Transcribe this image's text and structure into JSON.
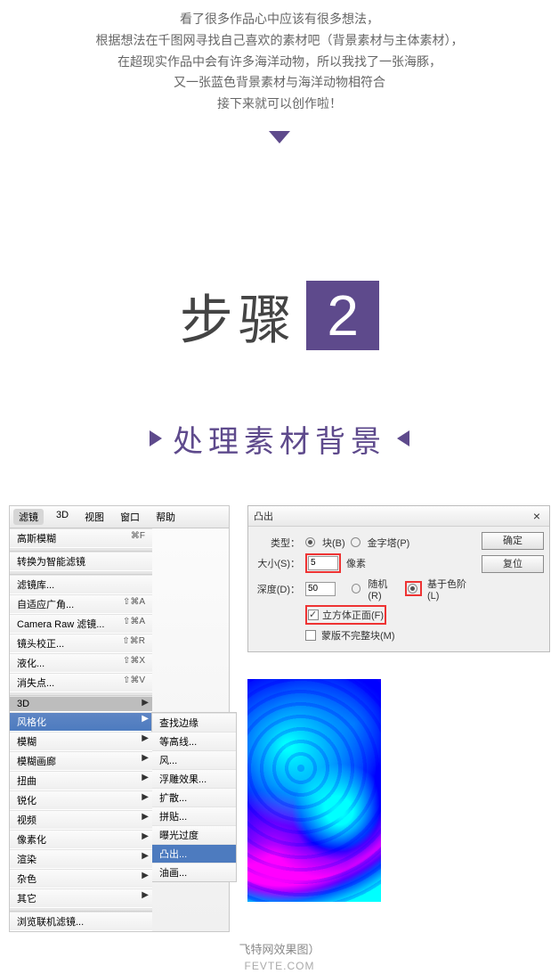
{
  "intro": {
    "line1": "看了很多作品心中应该有很多想法，",
    "line2": "根据想法在千图网寻找自己喜欢的素材吧（背景素材与主体素材），",
    "line3": "在超现实作品中会有许多海洋动物，所以我找了一张海豚，",
    "line4": "又一张蓝色背景素材与海洋动物相符合",
    "line5": "接下来就可以创作啦！"
  },
  "step": {
    "label": "步骤",
    "num": "2"
  },
  "section": {
    "title": "处理素材背景"
  },
  "menubar": {
    "filter": "滤镜",
    "threedee": "3D",
    "view": "视图",
    "window": "窗口",
    "help": "帮助"
  },
  "menu": {
    "gaussian": {
      "label": "高斯模糊",
      "shortcut": "⌘F"
    },
    "smartfilter": "转换为智能滤镜",
    "filtergallery": "滤镜库...",
    "adaptivewide": {
      "label": "自适应广角...",
      "shortcut": "⇧⌘A"
    },
    "cameraraw": {
      "label": "Camera Raw 滤镜...",
      "shortcut": "⇧⌘A"
    },
    "lenscorrect": {
      "label": "镜头校正...",
      "shortcut": "⇧⌘R"
    },
    "liquify": {
      "label": "液化...",
      "shortcut": "⇧⌘X"
    },
    "vanishing": {
      "label": "消失点...",
      "shortcut": "⇧⌘V"
    },
    "threedee": "3D",
    "stylize": "风格化",
    "blur": "模糊",
    "blurgallery": "模糊画廊",
    "distort": "扭曲",
    "sharpen": "锐化",
    "video": "视频",
    "pixelate": "像素化",
    "render": "渲染",
    "noise": "杂色",
    "other": "其它",
    "browse": "浏览联机滤镜..."
  },
  "submenu": {
    "findedges": "查找边缘",
    "contour": "等高线...",
    "wind": "风...",
    "emboss": "浮雕效果...",
    "diffuse": "扩散...",
    "tiles": "拼贴...",
    "solarize": "曝光过度",
    "extrude": "凸出...",
    "oilpaint": "油画..."
  },
  "dialog": {
    "title": "凸出",
    "type_label": "类型：",
    "type_block": "块(B)",
    "type_pyramid": "金字塔(P)",
    "size_label": "大小(S)：",
    "size_value": "5",
    "size_unit": "像素",
    "depth_label": "深度(D)：",
    "depth_value": "50",
    "depth_random": "随机(R)",
    "depth_level": "基于色阶(L)",
    "cube_front": "立方体正面(F)",
    "mask_incomplete": "蒙版不完整块(M)",
    "ok": "确定",
    "reset": "复位"
  },
  "caption": {
    "line1": "飞特网效果图）",
    "line2": "FEVTE.COM"
  }
}
